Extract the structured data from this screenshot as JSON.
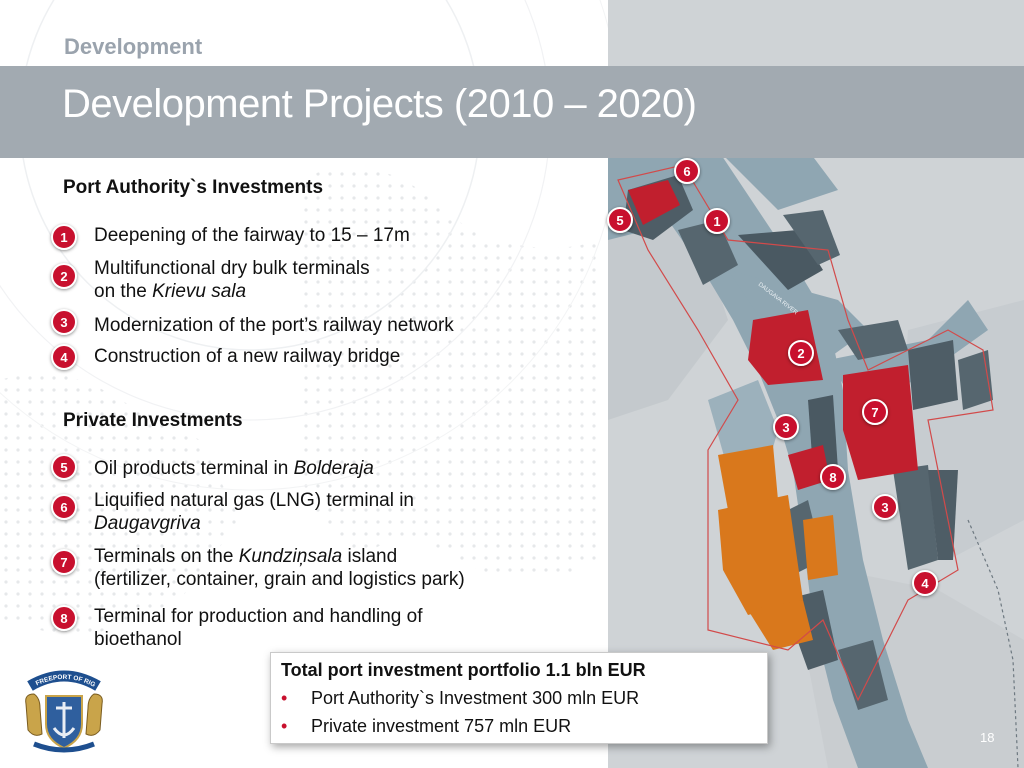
{
  "slide": {
    "section": "Development",
    "title": "Development Projects (2010 – 2020)",
    "page_number": "18"
  },
  "port_authority": {
    "heading": "Port Authority`s Investments",
    "items": [
      {
        "num": "1",
        "line1": "Deepening of the fairway to 15 – 17m"
      },
      {
        "num": "2",
        "line1": "Multifunctional dry bulk terminals",
        "line2_pre": "on the ",
        "line2_em": "Krievu sala"
      },
      {
        "num": "3",
        "line1": "Modernization of the port’s railway network"
      },
      {
        "num": "4",
        "line1": "Construction of a new railway bridge"
      }
    ]
  },
  "private": {
    "heading": "Private Investments",
    "items": [
      {
        "num": "5",
        "pre": "Oil products terminal in ",
        "em": "Bolderaja"
      },
      {
        "num": "6",
        "line1": "Liquified natural gas (LNG) terminal in",
        "line2_em": "Daugavgriva"
      },
      {
        "num": "7",
        "pre": "Terminals on the ",
        "em": "Kundziņsala",
        "post": " island",
        "line2": "(fertilizer, container, grain and logistics park)"
      },
      {
        "num": "8",
        "line1": "Terminal for production and handling of",
        "line2": "bioethanol"
      }
    ]
  },
  "summary": {
    "title": "Total port investment portfolio 1.1 bln EUR",
    "bullets": [
      "Port Authority`s  Investment 300 mln EUR",
      "Private investment 757 mln EUR"
    ],
    "bullet_symbol": "•"
  },
  "map": {
    "river_label": "DAUGAVA RIVER",
    "markers": [
      "6",
      "5",
      "1",
      "2",
      "7",
      "3",
      "8",
      "3",
      "4"
    ]
  },
  "logo": {
    "text": "FREEPORT OF RIGA",
    "icon": "freeport-of-riga-crest"
  },
  "colors": {
    "accent_red": "#c8102e",
    "title_bar": "#a2aab1",
    "section_label": "#9aa3ad",
    "water": "#8fa6b2",
    "land": "#d5d8db",
    "project_red": "#c11f2e",
    "private_orange": "#d9781c"
  }
}
